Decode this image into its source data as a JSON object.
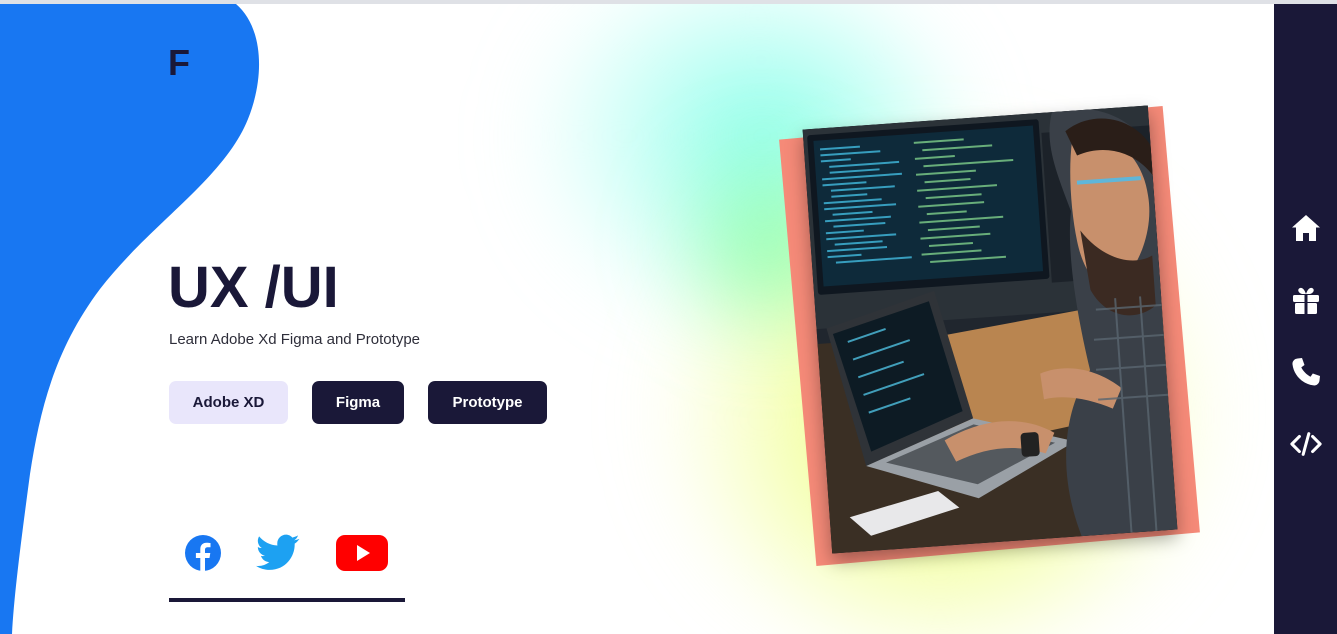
{
  "brand": {
    "logo_letter": "F"
  },
  "hero": {
    "title": "UX /UI",
    "subtitle": "Learn Adobe Xd Figma and Prototype",
    "buttons": [
      {
        "label": "Adobe XD"
      },
      {
        "label": "Figma"
      },
      {
        "label": "Prototype"
      }
    ]
  },
  "social": [
    {
      "icon": "facebook-icon"
    },
    {
      "icon": "twitter-icon"
    },
    {
      "icon": "youtube-icon"
    }
  ],
  "sidenav": {
    "items": [
      {
        "icon": "home-icon"
      },
      {
        "icon": "gift-icon"
      },
      {
        "icon": "phone-icon"
      },
      {
        "icon": "code-icon"
      }
    ]
  },
  "colors": {
    "blob": "#1877f2",
    "navy": "#1a1838",
    "photo_back": "#f58a78",
    "chip_light": "#e9e6fb",
    "facebook": "#1877f2",
    "twitter": "#1da1f2",
    "youtube": "#ff0000"
  }
}
